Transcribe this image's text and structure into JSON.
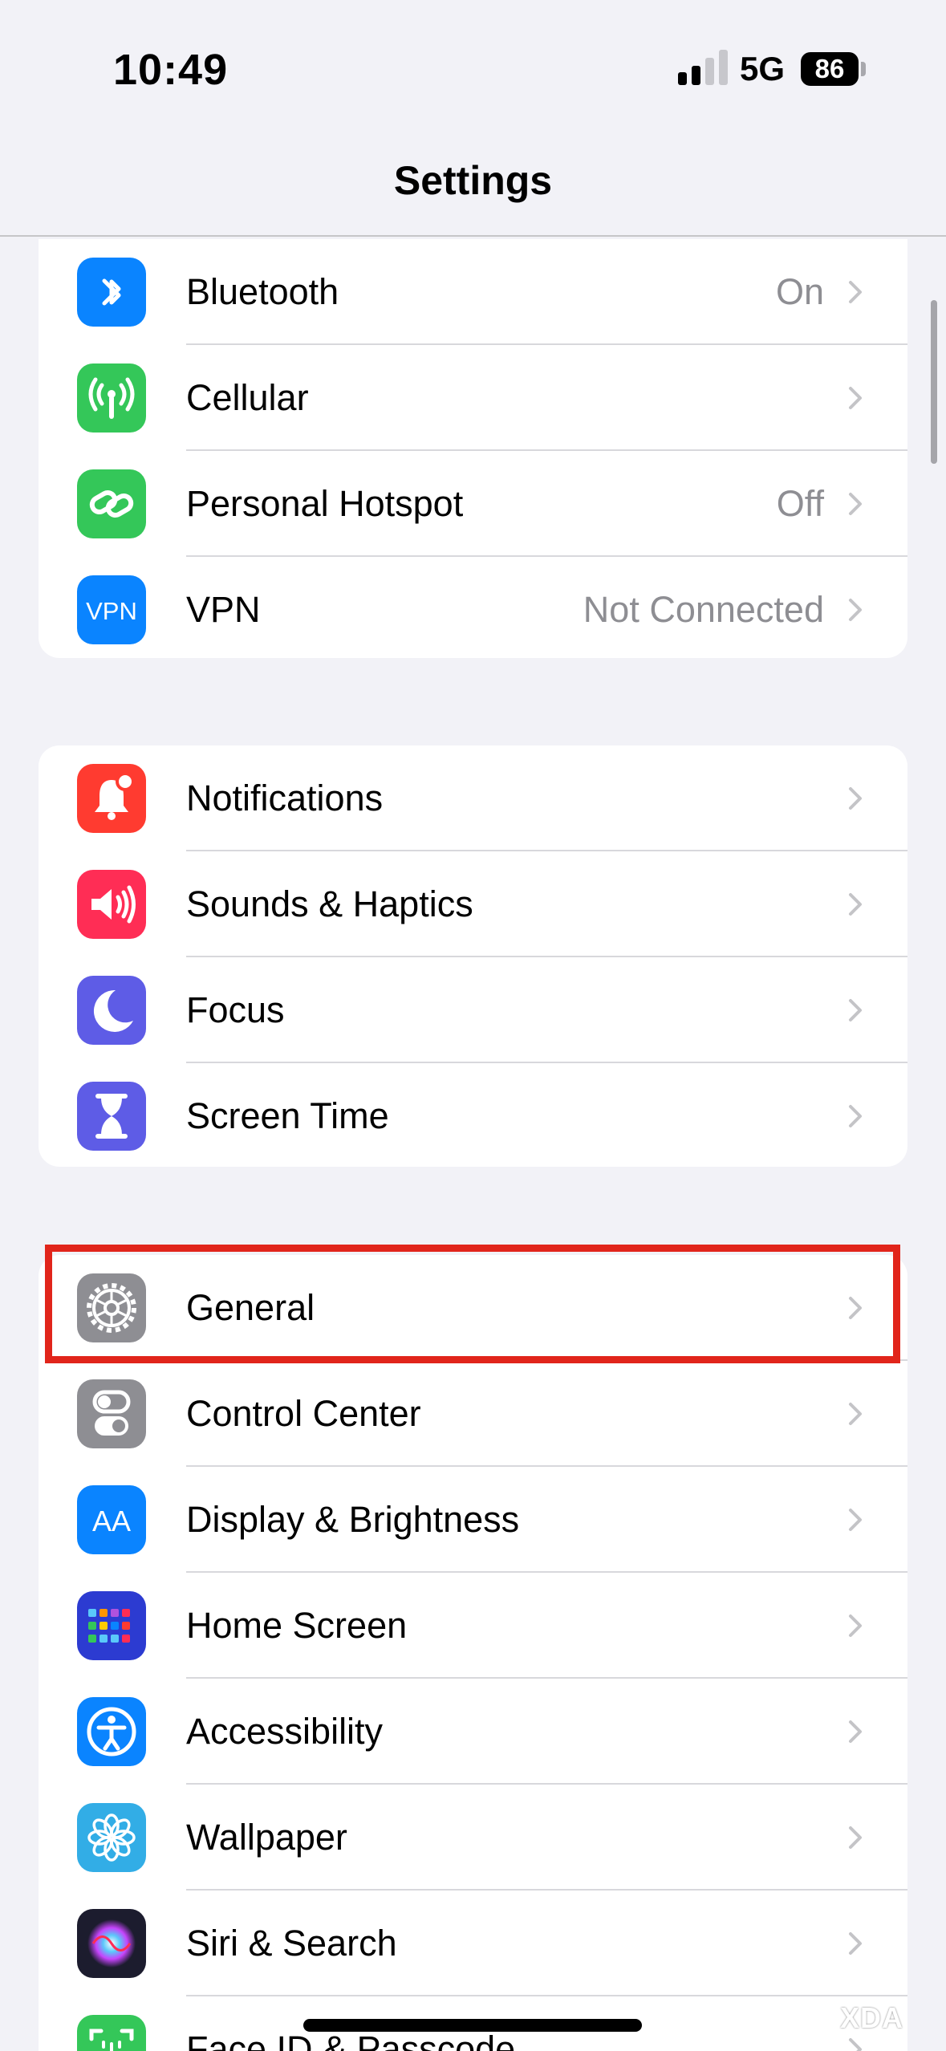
{
  "status_bar": {
    "time": "10:49",
    "network": "5G",
    "battery": "86"
  },
  "nav": {
    "title": "Settings"
  },
  "groups": [
    {
      "rows": [
        {
          "label": "Bluetooth",
          "value": "On",
          "icon": "bluetooth-icon",
          "color": "#0a84ff"
        },
        {
          "label": "Cellular",
          "value": "",
          "icon": "antenna-icon",
          "color": "#34c759"
        },
        {
          "label": "Personal Hotspot",
          "value": "Off",
          "icon": "hotspot-link-icon",
          "color": "#34c759"
        },
        {
          "label": "VPN",
          "value": "Not Connected",
          "icon": "vpn-icon",
          "icon_text": "VPN",
          "color": "#0a84ff"
        }
      ]
    },
    {
      "rows": [
        {
          "label": "Notifications",
          "value": "",
          "icon": "bell-icon",
          "color": "#ff3b30"
        },
        {
          "label": "Sounds & Haptics",
          "value": "",
          "icon": "speaker-icon",
          "color": "#ff2d55"
        },
        {
          "label": "Focus",
          "value": "",
          "icon": "moon-icon",
          "color": "#5e5ce6"
        },
        {
          "label": "Screen Time",
          "value": "",
          "icon": "hourglass-icon",
          "color": "#5e5ce6"
        }
      ]
    },
    {
      "rows": [
        {
          "label": "General",
          "value": "",
          "icon": "gear-icon",
          "color": "#8e8e93"
        },
        {
          "label": "Control Center",
          "value": "",
          "icon": "toggles-icon",
          "color": "#8e8e93"
        },
        {
          "label": "Display & Brightness",
          "value": "",
          "icon": "text-size-icon",
          "icon_text": "AA",
          "color": "#0a84ff"
        },
        {
          "label": "Home Screen",
          "value": "",
          "icon": "app-grid-icon",
          "color": "#2c3bd1"
        },
        {
          "label": "Accessibility",
          "value": "",
          "icon": "accessibility-icon",
          "color": "#0a84ff"
        },
        {
          "label": "Wallpaper",
          "value": "",
          "icon": "flower-icon",
          "color": "#32ade6"
        },
        {
          "label": "Siri & Search",
          "value": "",
          "icon": "siri-icon",
          "color": "#1c1c2e"
        },
        {
          "label": "Face ID & Passcode",
          "value": "",
          "icon": "face-id-icon",
          "color": "#34c759"
        }
      ]
    }
  ],
  "highlighted_row": "General",
  "watermark": "XDA"
}
